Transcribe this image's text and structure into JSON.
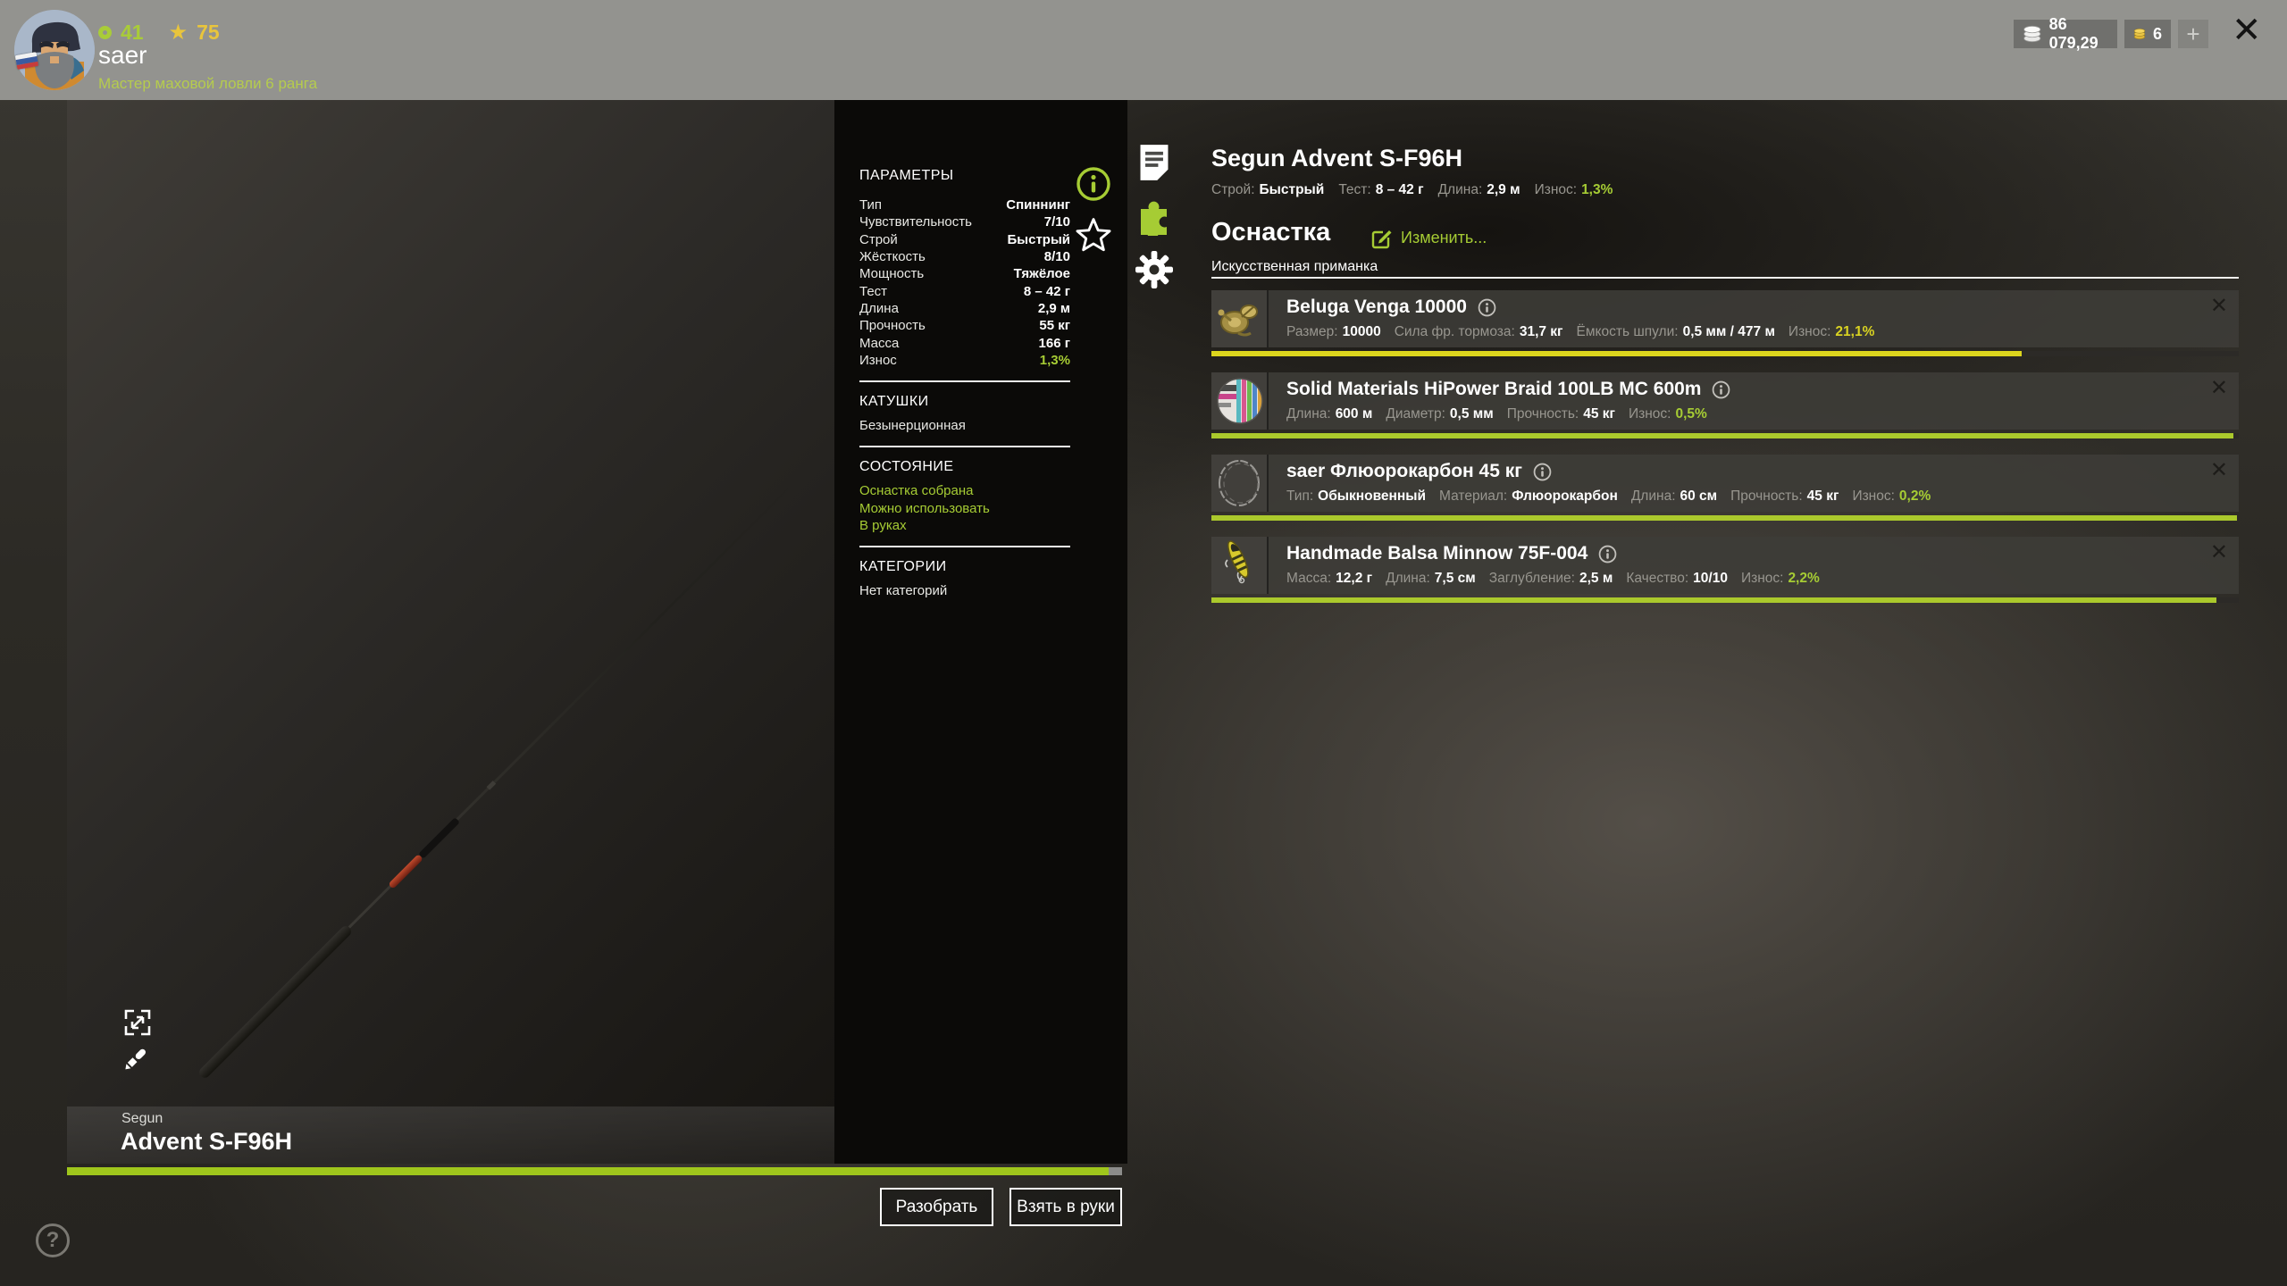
{
  "colors": {
    "accent": "#a6cc34",
    "gold": "#e9c53c",
    "header_gray": "#93938f",
    "bar_yellow": "#dcd51d",
    "bar_green": "#abc92c",
    "progress_green": "#9fc61c"
  },
  "header": {
    "level": "41",
    "stars": "75",
    "player_name": "saer",
    "player_title": "Мастер маховой ловли 6 ранга",
    "silver_balance": "86 079,29",
    "gold_balance": "6",
    "add_funds_label": "+",
    "close_label": "✕"
  },
  "viewer": {
    "brand": "Segun",
    "model": "Advent S-F96H",
    "durability_pct": 98.7,
    "disassemble_label": "Разобрать",
    "take_label": "Взять в руки"
  },
  "params_panel": {
    "title": "ПАРАМЕТРЫ",
    "rows": [
      {
        "label": "Тип",
        "value": "Спиннинг"
      },
      {
        "label": "Чувствительность",
        "value": "7/10"
      },
      {
        "label": "Строй",
        "value": "Быстрый"
      },
      {
        "label": "Жёсткость",
        "value": "8/10"
      },
      {
        "label": "Мощность",
        "value": "Тяжёлое"
      },
      {
        "label": "Тест",
        "value": "8 – 42 г"
      },
      {
        "label": "Длина",
        "value": "2,9 м"
      },
      {
        "label": "Прочность",
        "value": "55 кг"
      },
      {
        "label": "Масса",
        "value": "166 г"
      },
      {
        "label": "Износ",
        "value": "1,3%",
        "highlight": true
      }
    ],
    "reels_title": "КАТУШКИ",
    "reels_value": "Безынерционная",
    "state_title": "СОСТОЯНИЕ",
    "state_lines": [
      "Оснастка собрана",
      "Можно использовать",
      "В руках"
    ],
    "categories_title": "КАТЕГОРИИ",
    "categories_value": "Нет категорий"
  },
  "rig_panel": {
    "title": "Segun Advent S-F96H",
    "stats": [
      {
        "label": "Строй:",
        "value": "Быстрый"
      },
      {
        "label": "Тест:",
        "value": "8 – 42 г"
      },
      {
        "label": "Длина:",
        "value": "2,9 м"
      },
      {
        "label": "Износ:",
        "value": "1,3%",
        "highlight": true
      }
    ],
    "section_title": "Оснастка",
    "edit_label": "Изменить...",
    "subtitle": "Искусственная приманка",
    "items": [
      {
        "kind": "reel",
        "name": "Beluga Venga 10000",
        "wear_color": "#d9d322",
        "bar_color": "#dcd51d",
        "bar_fill": 78.9,
        "stats": [
          {
            "label": "Размер:",
            "value": "10000"
          },
          {
            "label": "Сила фр. тормоза:",
            "value": "31,7 кг"
          },
          {
            "label": "Ёмкость шпули:",
            "value": "0,5 мм / 477 м"
          },
          {
            "label": "Износ:",
            "value": "21,1%",
            "highlight": true
          }
        ]
      },
      {
        "kind": "braid",
        "name": "Solid Materials HiPower Braid 100LB MC 600m",
        "wear_color": "#a6cc34",
        "bar_color": "#abc92c",
        "bar_fill": 99.5,
        "stats": [
          {
            "label": "Длина:",
            "value": "600 м"
          },
          {
            "label": "Диаметр:",
            "value": "0,5 мм"
          },
          {
            "label": "Прочность:",
            "value": "45 кг"
          },
          {
            "label": "Износ:",
            "value": "0,5%",
            "highlight": true
          }
        ]
      },
      {
        "kind": "leader",
        "name": "saer Флюорокарбон 45 кг",
        "wear_color": "#a6cc34",
        "bar_color": "#abc92c",
        "bar_fill": 99.8,
        "stats": [
          {
            "label": "Тип:",
            "value": "Обыкновенный"
          },
          {
            "label": "Материал:",
            "value": "Флюорокарбон"
          },
          {
            "label": "Длина:",
            "value": "60 см"
          },
          {
            "label": "Прочность:",
            "value": "45 кг"
          },
          {
            "label": "Износ:",
            "value": "0,2%",
            "highlight": true
          }
        ]
      },
      {
        "kind": "lure",
        "name": "Handmade Balsa Minnow 75F-004",
        "wear_color": "#a6cc34",
        "bar_color": "#abc92c",
        "bar_fill": 97.8,
        "stats": [
          {
            "label": "Масса:",
            "value": "12,2 г"
          },
          {
            "label": "Длина:",
            "value": "7,5 см"
          },
          {
            "label": "Заглубление:",
            "value": "2,5 м"
          },
          {
            "label": "Качество:",
            "value": "10/10"
          },
          {
            "label": "Износ:",
            "value": "2,2%",
            "highlight": true
          }
        ]
      }
    ]
  },
  "help_label": "?"
}
